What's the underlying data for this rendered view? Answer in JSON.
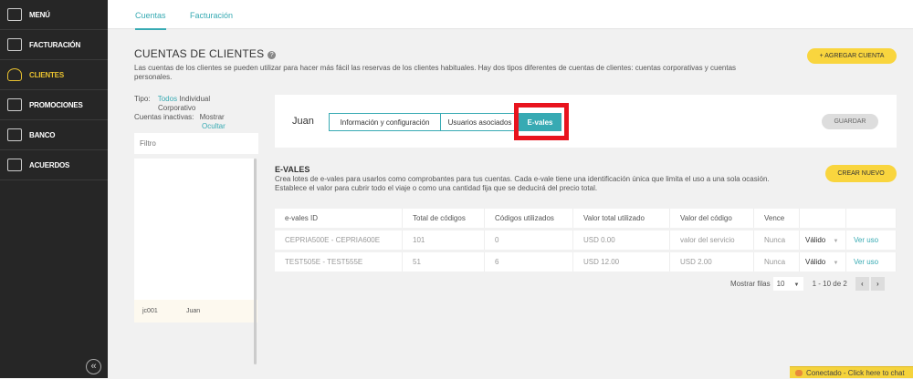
{
  "sidebar": {
    "items": [
      {
        "label": "MENÚ",
        "icon": "grid-icon"
      },
      {
        "label": "FACTURACIÓN",
        "icon": "briefcase-icon"
      },
      {
        "label": "CLIENTES",
        "icon": "user-icon"
      },
      {
        "label": "PROMOCIONES",
        "icon": "gift-icon"
      },
      {
        "label": "BANCO",
        "icon": "bank-icon"
      },
      {
        "label": "ACUERDOS",
        "icon": "document-icon"
      }
    ],
    "active": "CLIENTES",
    "collapse": "«"
  },
  "topnav": {
    "tabs": [
      "Cuentas",
      "Facturación"
    ],
    "active": "Cuentas"
  },
  "page": {
    "title": "CUENTAS DE CLIENTES",
    "help": "?",
    "description": "Las cuentas de los clientes se pueden utilizar para hacer más fácil las reservas de los clientes habituales. Hay dos tipos diferentes de cuentas de clientes: cuentas corporativas y cuentas personales.",
    "add_button": "+ AGREGAR CUENTA"
  },
  "filters": {
    "tipo_label": "Tipo:",
    "tipo_options": [
      "Todos",
      "Individual",
      "Corporativo"
    ],
    "inactive_label": "Cuentas inactivas:",
    "inactive_options": [
      "Mostrar",
      "Ocultar"
    ],
    "filter_placeholder": "Filtro"
  },
  "accounts": [
    {
      "id": "jc001",
      "name": "Juan"
    }
  ],
  "account": {
    "name": "Juan",
    "tabs": [
      "Información y configuración",
      "Usuarios asociados",
      "E-vales"
    ],
    "active_tab": "E-vales",
    "save": "GUARDAR"
  },
  "evales": {
    "title": "E-VALES",
    "description": "Crea lotes de e-vales para usarlos como comprobantes para tus cuentas. Cada e-vale tiene una identificación única que limita el uso a una sola ocasión. Establece el valor para cubrir todo el viaje o como una cantidad fija que se deducirá del precio total.",
    "create": "CREAR NUEVO",
    "columns": [
      "e-vales ID",
      "Total de códigos",
      "Códigos utilizados",
      "Valor total utilizado",
      "Valor del código",
      "Vence",
      "",
      ""
    ],
    "rows": [
      [
        "CEPRIA500E - CEPRIA600E",
        "101",
        "0",
        "USD 0.00",
        "valor del servicio",
        "Nunca",
        "Válido",
        "Ver uso"
      ],
      [
        "TEST505E - TEST555E",
        "51",
        "6",
        "USD 12.00",
        "USD 2.00",
        "Nunca",
        "Válido",
        "Ver uso"
      ]
    ],
    "pagination": {
      "label": "Mostrar filas",
      "rows": "10",
      "range": "1 - 10 de 2"
    }
  },
  "chat": {
    "text": "Conectado - Click here to chat"
  },
  "colors": {
    "accent": "#37aab3",
    "yellow": "#f9d53e",
    "sidebar": "#262626",
    "highlight": "#e8141e"
  }
}
